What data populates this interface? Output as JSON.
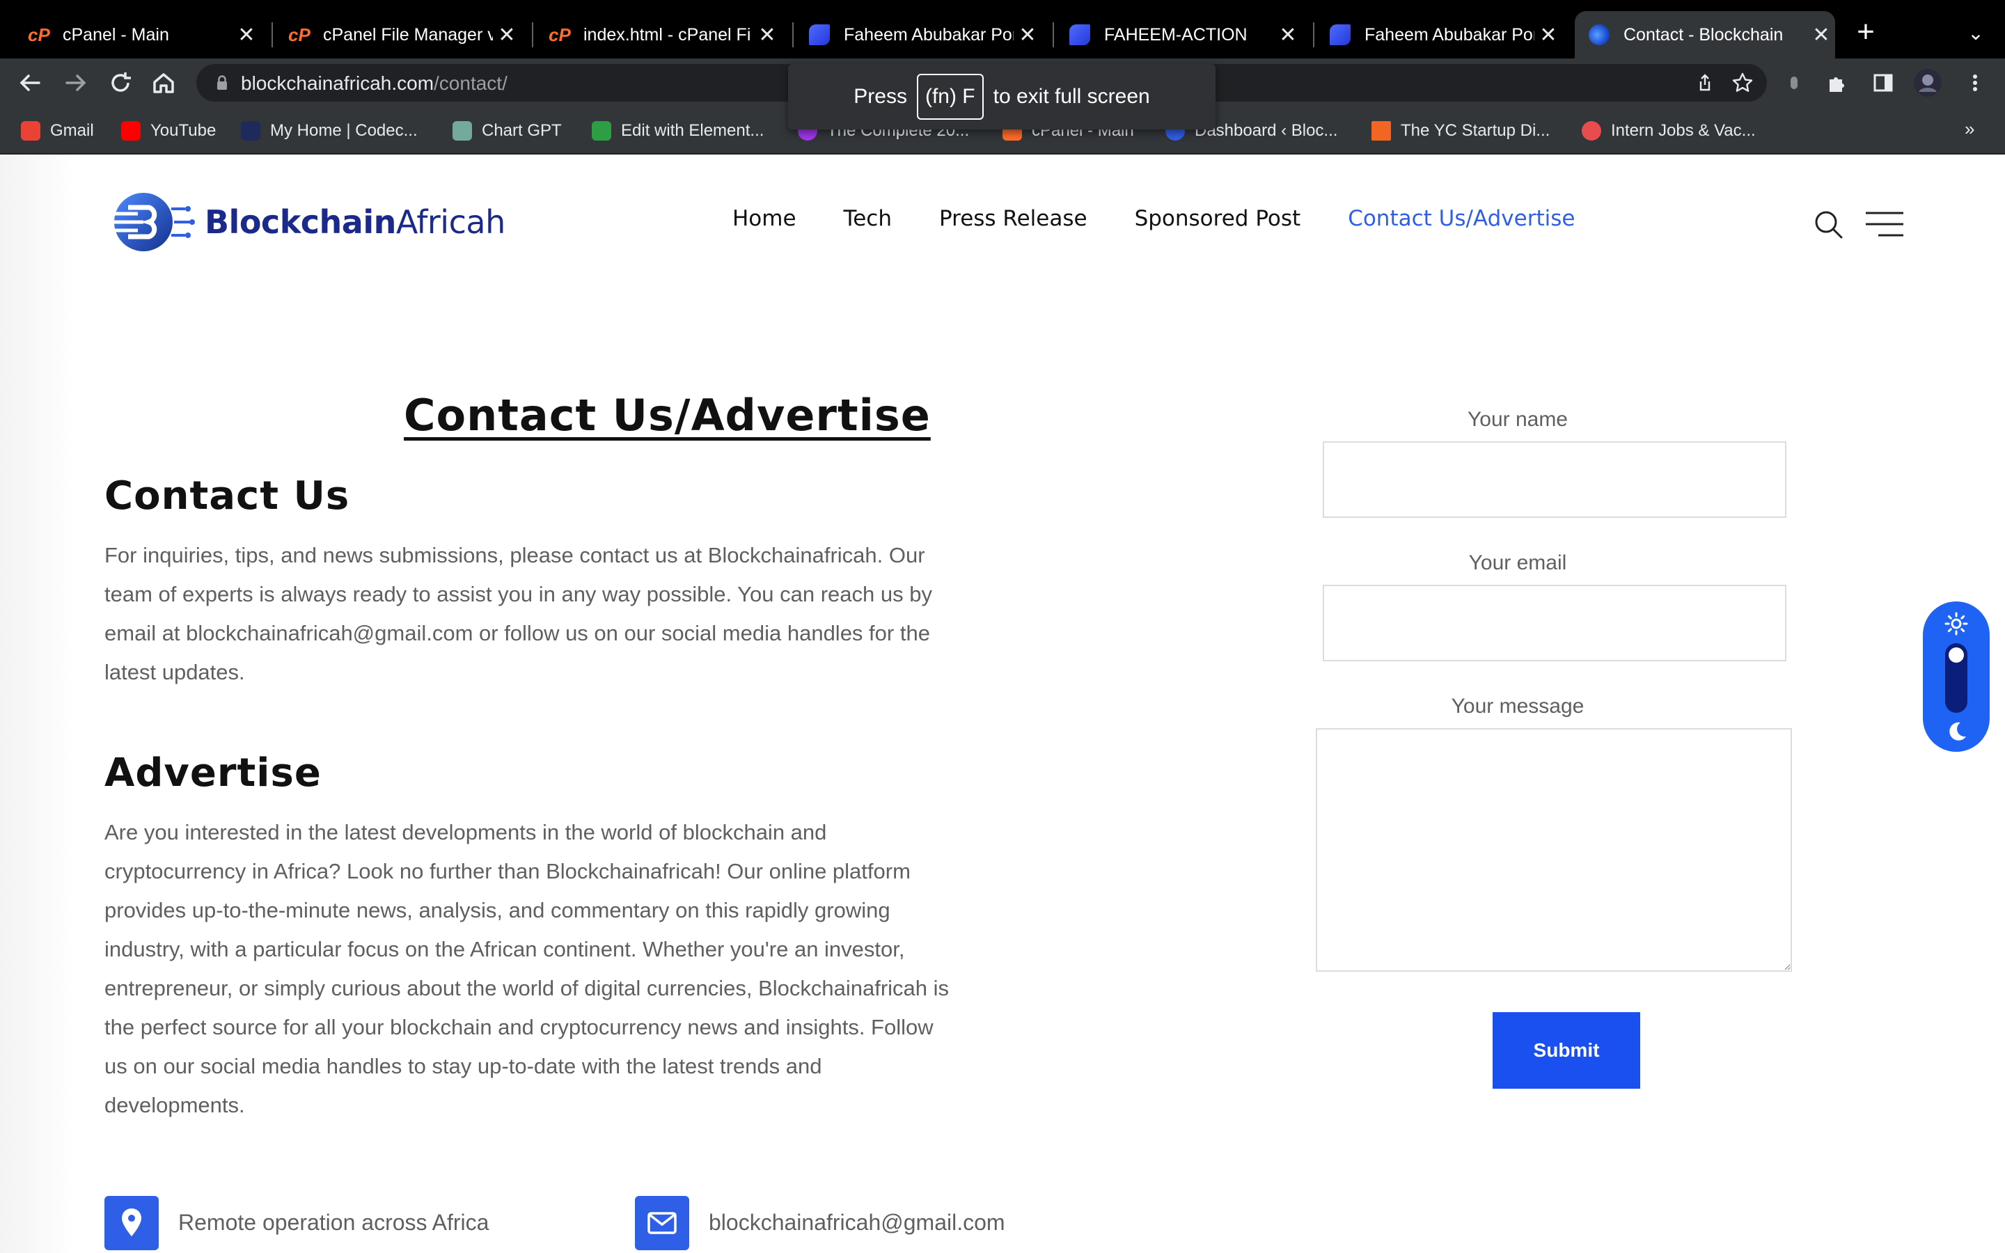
{
  "browser": {
    "tabs": [
      {
        "title": "cPanel - Main",
        "icon": "cpanel-icon",
        "active": false
      },
      {
        "title": "cPanel File Manager v",
        "icon": "cpanel-icon",
        "active": false
      },
      {
        "title": "index.html - cPanel Fi",
        "icon": "cpanel-icon",
        "active": false
      },
      {
        "title": "Faheem Abubakar Por",
        "icon": "f-logo-icon",
        "active": false
      },
      {
        "title": "FAHEEM-ACTION",
        "icon": "f-logo-icon",
        "active": false
      },
      {
        "title": "Faheem Abubakar Por",
        "icon": "f-logo-icon",
        "active": false
      },
      {
        "title": "Contact - Blockchain",
        "icon": "blockchain-icon",
        "active": true
      }
    ],
    "close_glyph": "✕",
    "new_tab_glyph": "+",
    "overflow_glyph": "⌄",
    "url_host": "blockchainafricah.com",
    "url_path": "/contact/",
    "bookmarks": [
      {
        "label": "Gmail",
        "icon": "gmail-icon",
        "color": "#ea4335"
      },
      {
        "label": "YouTube",
        "icon": "youtube-icon",
        "color": "#ff0000"
      },
      {
        "label": "My Home | Codec...",
        "icon": "codecademy-icon",
        "color": "#1f2a5c"
      },
      {
        "label": "Chart GPT",
        "icon": "chatgpt-icon",
        "color": "#74aa9c"
      },
      {
        "label": "Edit with Element...",
        "icon": "elementor-icon",
        "color": "#2e9e44"
      },
      {
        "label": "The Complete 20...",
        "icon": "udemy-icon",
        "color": "#a435f0"
      },
      {
        "label": "cPanel - Main",
        "icon": "cpanel-icon",
        "color": "#ff6c2c"
      },
      {
        "label": "Dashboard ‹ Bloc...",
        "icon": "blockchain-icon",
        "color": "#2f5fe6"
      },
      {
        "label": "The YC Startup Di...",
        "icon": "ycombinator-icon",
        "color": "#f26522"
      },
      {
        "label": "Intern Jobs & Vac...",
        "icon": "fis-icon",
        "color": "#e84c4c"
      }
    ],
    "bookmarks_more": "»",
    "toast": {
      "before": "Press",
      "key": "(fn) F",
      "after": "to exit full screen"
    }
  },
  "site": {
    "logo_strong": "Blockchain",
    "logo_light": "Africah",
    "nav": [
      "Home",
      "Tech",
      "Press Release",
      "Sponsored Post",
      "Contact Us/Advertise"
    ],
    "accent_color": "#2f5fe6"
  },
  "content": {
    "page_title": "Contact Us/Advertise",
    "contact_heading": "Contact Us",
    "contact_text": "For inquiries, tips, and news submissions, please contact us at Blockchainafricah. Our team of experts is always ready to assist you in any way possible. You can reach us by email at blockchainafricah@gmail.com or follow us on our social media handles for the latest updates.",
    "advertise_heading": "Advertise",
    "advertise_text": "Are you interested in the latest developments in the world of blockchain and cryptocurrency in Africa? Look no further than Blockchainafricah! Our online platform provides up-to-the-minute news, analysis, and commentary on this rapidly growing industry, with a particular focus on the African continent. Whether you're an investor, entrepreneur, or simply curious about the world of digital currencies, Blockchainafricah is the perfect source for all your blockchain and cryptocurrency news and insights. Follow us on our social media handles to stay up-to-date with the latest trends and developments.",
    "location_text": "Remote operation across Africa",
    "email_text": "blockchainafricah@gmail.com"
  },
  "form": {
    "name_label": "Your name",
    "name_value": "",
    "email_label": "Your email",
    "email_value": "",
    "message_label": "Your message",
    "message_value": "",
    "submit_label": "Submit"
  }
}
